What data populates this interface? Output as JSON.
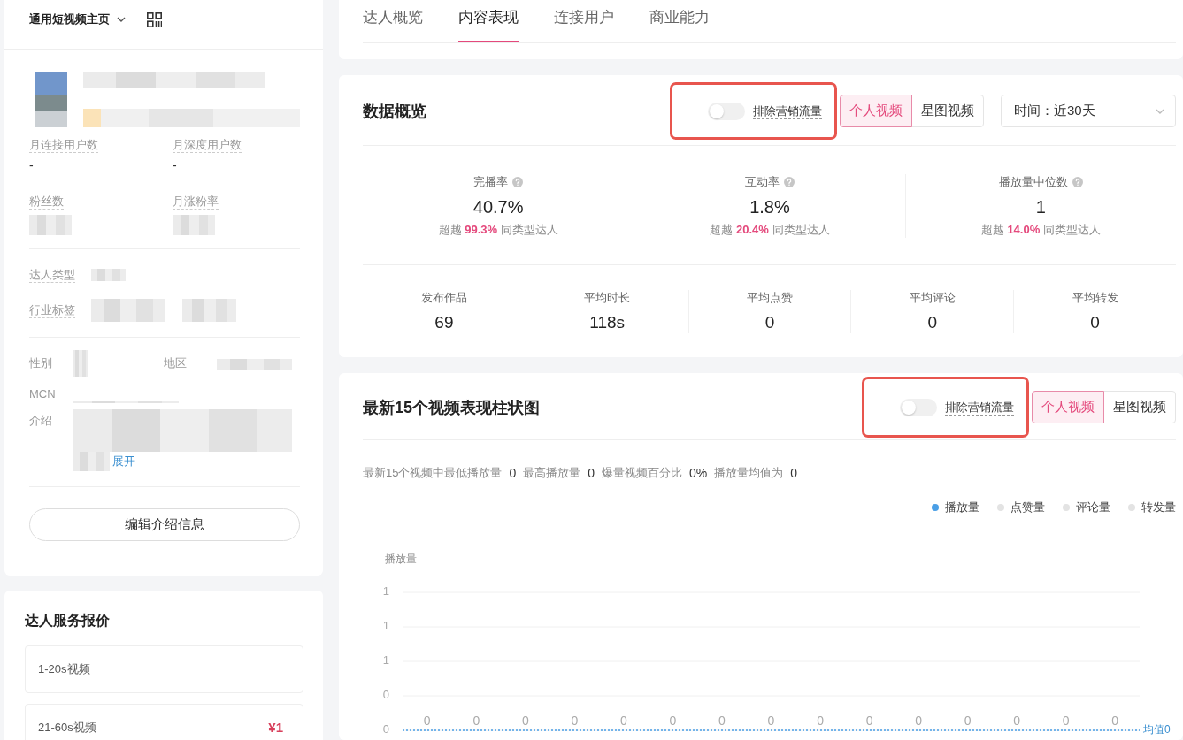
{
  "sidebar": {
    "page_selector": {
      "label": "通用短视频主页"
    },
    "profile": {
      "blurred": true
    },
    "stats": [
      {
        "label": "月连接用户数",
        "value": "-"
      },
      {
        "label": "月深度用户数",
        "value": "-"
      },
      {
        "label": "粉丝数",
        "blurred": true
      },
      {
        "label": "月涨粉率",
        "blurred": true
      }
    ],
    "attributes": [
      {
        "label": "达人类型",
        "blurred": true
      },
      {
        "label": "行业标签",
        "blurred": true
      }
    ],
    "details": [
      {
        "label": "性别",
        "blurred": true
      },
      {
        "label": "地区",
        "blurred": true
      },
      {
        "label": "MCN",
        "blurred": true
      },
      {
        "label": "介绍",
        "blurred": true,
        "expand_link": "展开"
      }
    ],
    "edit_button": {
      "label": "编辑介绍信息"
    }
  },
  "pricing": {
    "title": "达人服务报价",
    "items": [
      {
        "label": "1-20s视频"
      },
      {
        "label": "21-60s视频",
        "price": "¥1"
      }
    ]
  },
  "tabs": [
    {
      "label": "达人概览",
      "selected": false
    },
    {
      "label": "内容表现",
      "selected": true
    },
    {
      "label": "连接用户",
      "selected": false
    },
    {
      "label": "商业能力",
      "selected": false
    }
  ],
  "overview": {
    "title": "数据概览",
    "exclude_marketing": {
      "label": "排除营销流量",
      "on": false,
      "highlighted": true
    },
    "video_types": [
      {
        "label": "个人视频",
        "selected": true
      },
      {
        "label": "星图视频",
        "selected": false
      }
    ],
    "time_select": {
      "value": "时间：近30天"
    },
    "rates": [
      {
        "label": "完播率",
        "value": "40.7%",
        "rank": "超越 **99.3%** 同类型达人"
      },
      {
        "label": "互动率",
        "value": "1.8%",
        "rank": "超越 **20.4%** 同类型达人"
      },
      {
        "label": "播放量中位数",
        "value": "1",
        "rank": "超越 **14.0%** 同类型达人"
      }
    ],
    "counts": [
      {
        "label": "发布作品",
        "value": "69"
      },
      {
        "label": "平均时长",
        "value": "118s"
      },
      {
        "label": "平均点赞",
        "value": "0"
      },
      {
        "label": "平均评论",
        "value": "0"
      },
      {
        "label": "平均转发",
        "value": "0"
      }
    ]
  },
  "video_chart": {
    "title": "最新15个视频表现柱状图",
    "exclude_marketing": {
      "label": "排除营销流量",
      "on": false,
      "highlighted": true
    },
    "video_types": [
      {
        "label": "个人视频",
        "selected": true
      },
      {
        "label": "星图视频",
        "selected": false
      }
    ],
    "summary": [
      {
        "label": "最新15个视频中最低播放量",
        "value": "0"
      },
      {
        "label": "最高播放量",
        "value": "0"
      },
      {
        "label": "爆量视频百分比",
        "value": "0%"
      },
      {
        "label": "播放量均值为",
        "value": "0"
      }
    ],
    "legend": [
      {
        "label": "播放量",
        "selected": true
      },
      {
        "label": "点赞量",
        "selected": false
      },
      {
        "label": "评论量",
        "selected": false
      },
      {
        "label": "转发量",
        "selected": false
      }
    ],
    "chart_data": {
      "type": "bar",
      "ylabel": "播放量",
      "values": [
        0,
        0,
        0,
        0,
        0,
        0,
        0,
        0,
        0,
        0,
        0,
        0,
        0,
        0,
        0
      ],
      "ylim": [
        0,
        1
      ],
      "yticks": [
        {
          "value": 0,
          "label": "0"
        },
        {
          "value": 0.25,
          "label": "0"
        },
        {
          "value": 0.5,
          "label": "1"
        },
        {
          "value": 0.75,
          "label": "1"
        },
        {
          "value": 1,
          "label": "1"
        }
      ],
      "grid": true,
      "data_labels": true,
      "ref_lines": [
        {
          "label": "均值0"
        }
      ]
    }
  }
}
